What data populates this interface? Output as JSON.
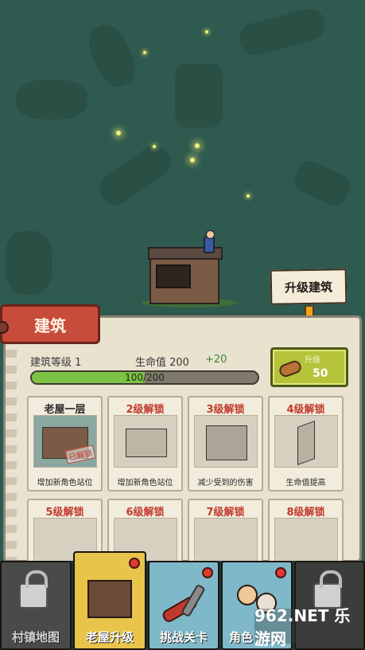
{
  "scene": {
    "callout_text": "升级建筑"
  },
  "panel": {
    "title": "建筑",
    "level_label": "建筑等级 1",
    "hp_label": "生命值 200",
    "hp_bonus": "+20",
    "progress_text": "100/200",
    "progress_fraction": 0.5,
    "upgrade_button": {
      "label": "升级",
      "cost": "50",
      "icon": "wood-log-icon"
    },
    "cards": [
      {
        "title": "老屋一层",
        "desc": "增加新角色站位",
        "unlocked": true,
        "stamp": "已解锁"
      },
      {
        "title": "2级解锁",
        "desc": "增加新角色站位",
        "unlocked": false
      },
      {
        "title": "3级解锁",
        "desc": "减少受到的伤害",
        "unlocked": false
      },
      {
        "title": "4级解锁",
        "desc": "生命值提高",
        "unlocked": false
      },
      {
        "title": "5级解锁",
        "desc": "",
        "unlocked": false
      },
      {
        "title": "6级解锁",
        "desc": "",
        "unlocked": false
      },
      {
        "title": "7级解锁",
        "desc": "",
        "unlocked": false
      },
      {
        "title": "8级解锁",
        "desc": "",
        "unlocked": false
      }
    ]
  },
  "bottom_nav": [
    {
      "label": "村镇地图",
      "locked": true
    },
    {
      "label": "老屋升级",
      "active": true
    },
    {
      "label": "挑战关卡"
    },
    {
      "label": "角色"
    }
  ],
  "watermark": "962.NET 乐游网"
}
